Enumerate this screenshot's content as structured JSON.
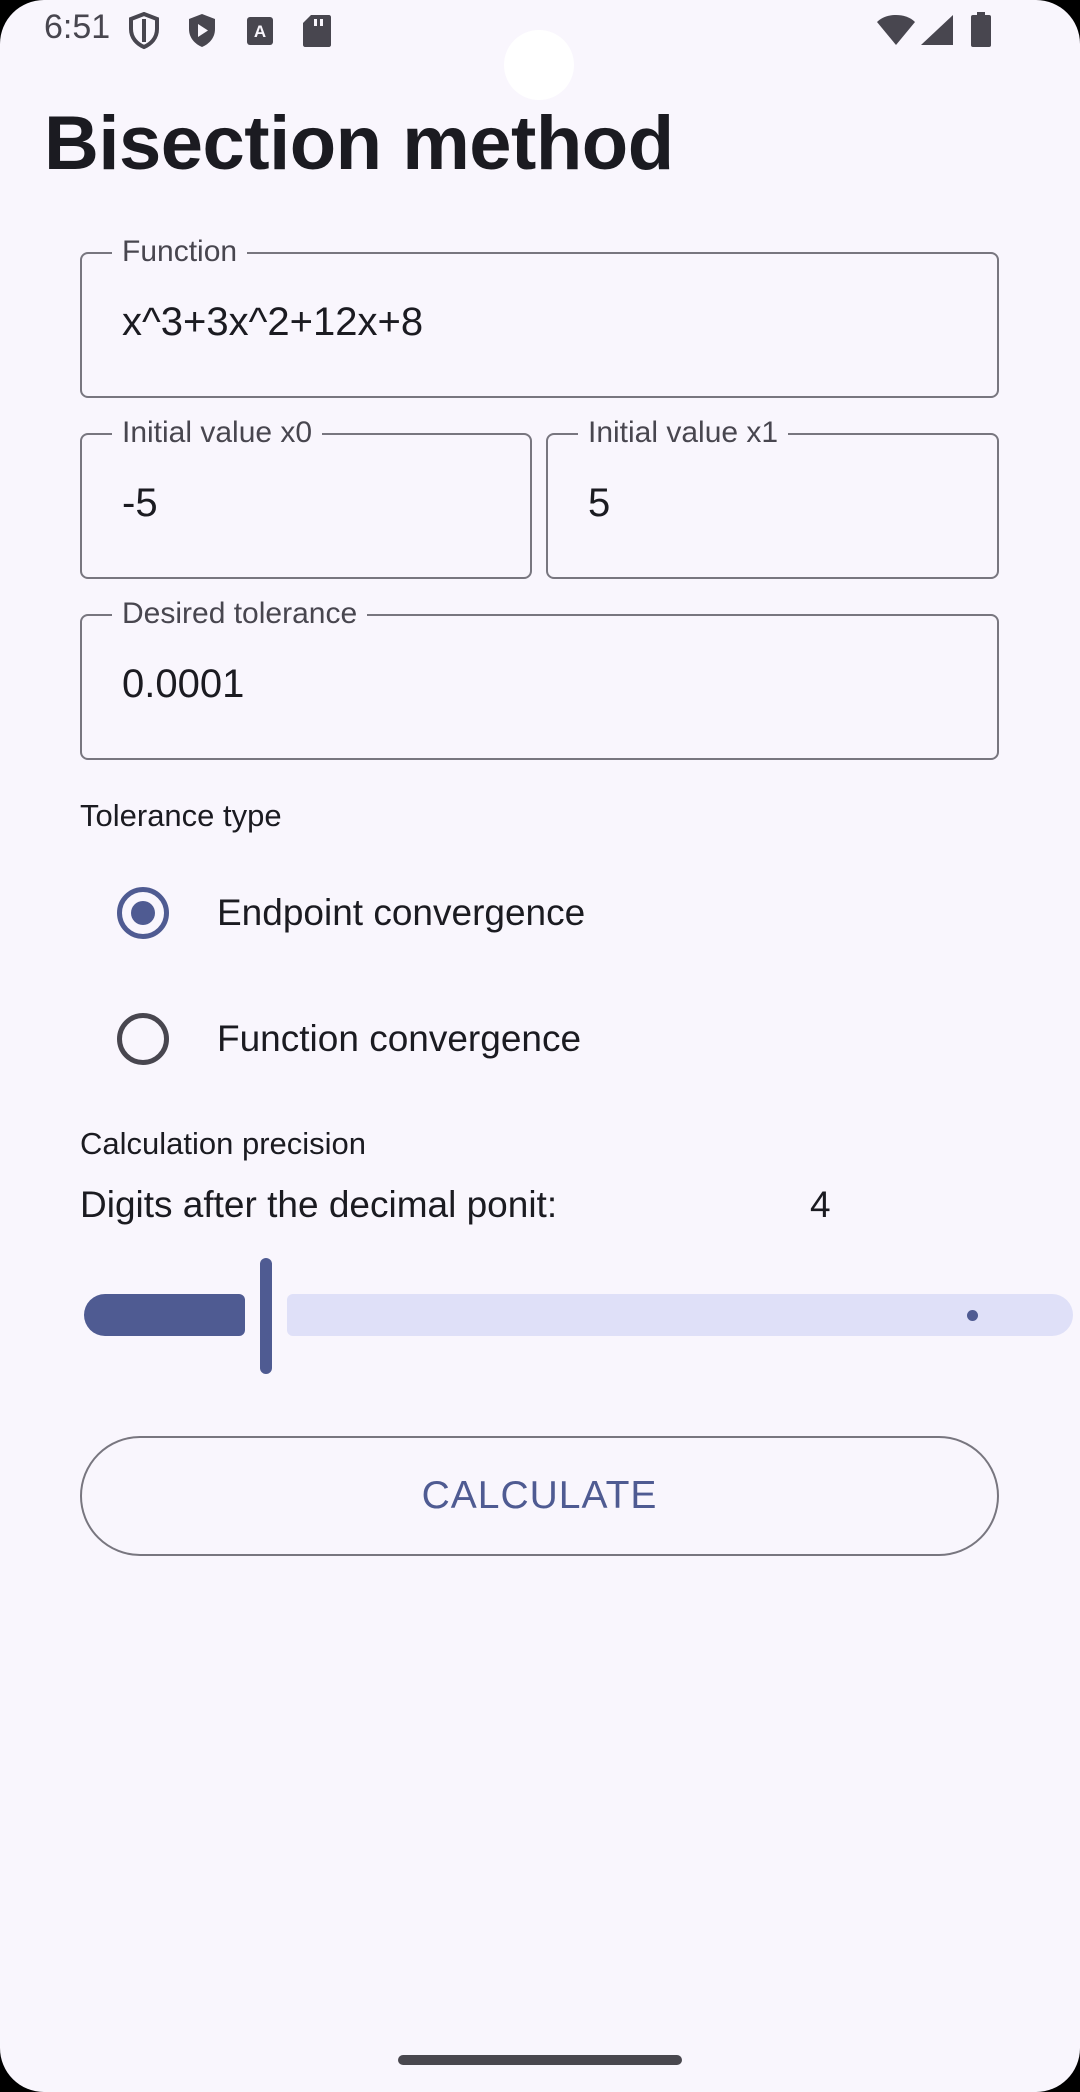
{
  "status_bar": {
    "time": "6:51",
    "left_icons": [
      "shield-outline-icon",
      "play-protect-icon",
      "font-a-icon",
      "sd-card-icon"
    ],
    "right_icons": [
      "wifi-icon",
      "cellular-signal-icon",
      "battery-icon"
    ]
  },
  "page": {
    "title": "Bisection method"
  },
  "form": {
    "function": {
      "label": "Function",
      "value": "x^3+3x^2+12x+8"
    },
    "x0": {
      "label": "Initial value x0",
      "value": "-5"
    },
    "x1": {
      "label": "Initial value x1",
      "value": "5"
    },
    "tolerance": {
      "label": "Desired tolerance",
      "value": "0.0001"
    }
  },
  "tolerance_type": {
    "label": "Tolerance type",
    "options": [
      {
        "label": "Endpoint convergence",
        "selected": true
      },
      {
        "label": "Function convergence",
        "selected": false
      }
    ]
  },
  "precision": {
    "section_label": "Calculation precision",
    "digits_label": "Digits after the decimal ponit:",
    "digits_value": "4",
    "slider_fraction": 0.19
  },
  "actions": {
    "calculate_label": "CALCULATE"
  },
  "colors": {
    "background": "#f9f6fd",
    "primary": "#4f5b92",
    "outline": "#78767f",
    "track_inactive": "#dfe0f8",
    "text": "#1b1b21"
  }
}
